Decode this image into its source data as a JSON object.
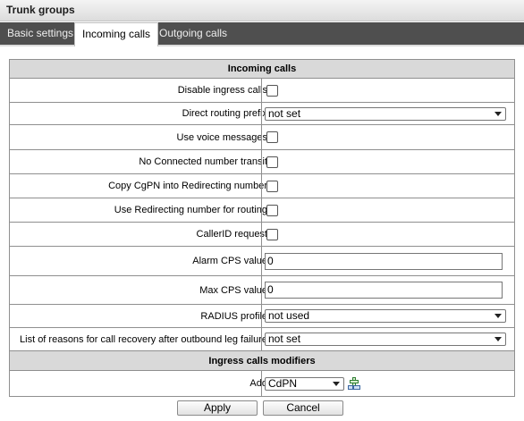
{
  "window": {
    "title": "Trunk groups"
  },
  "tabs": [
    {
      "label": "Basic settings",
      "active": false
    },
    {
      "label": "Incoming calls",
      "active": true
    },
    {
      "label": "Outgoing calls",
      "active": false
    }
  ],
  "incoming": {
    "header": "Incoming calls",
    "disable_ingress": {
      "label": "Disable ingress calls",
      "checked": false
    },
    "direct_routing_prefix": {
      "label": "Direct routing prefix",
      "value": "not set"
    },
    "use_voice_messages": {
      "label": "Use voice messages",
      "checked": false
    },
    "no_connected_transit": {
      "label": "No Connected number transit",
      "checked": false
    },
    "copy_cgpn": {
      "label": "Copy CgPN into Redirecting number",
      "checked": false
    },
    "use_redirecting": {
      "label": "Use Redirecting number for routing",
      "checked": false
    },
    "callerid_request": {
      "label": "CallerID request",
      "checked": false
    },
    "alarm_cps": {
      "label": "Alarm CPS value",
      "value": "0"
    },
    "max_cps": {
      "label": "Max CPS value",
      "value": "0"
    },
    "radius_profile": {
      "label": "RADIUS profile",
      "value": "not used"
    },
    "recovery_reasons": {
      "label": "List of reasons for call recovery after outbound leg failure",
      "value": "not set"
    }
  },
  "modifiers": {
    "header": "Ingress calls modifiers",
    "add_label": "Add",
    "add_value": "CdPN",
    "add_icon": "add-modifier-icon"
  },
  "buttons": {
    "apply": "Apply",
    "cancel": "Cancel"
  }
}
